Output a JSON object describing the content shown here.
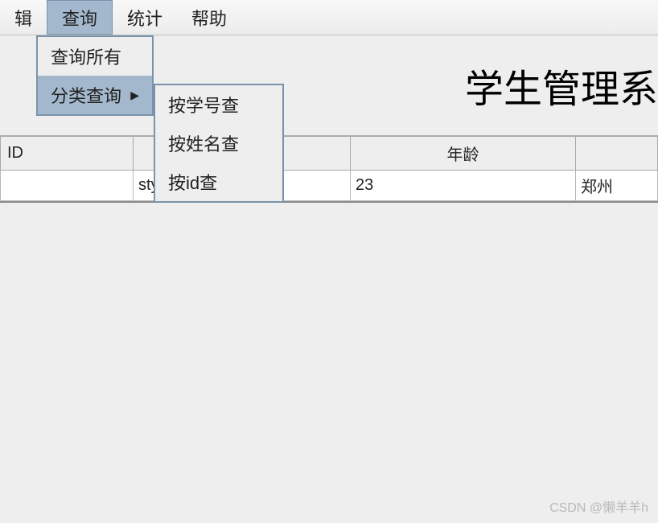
{
  "menubar": {
    "items": [
      {
        "label": "辑"
      },
      {
        "label": "查询"
      },
      {
        "label": "统计"
      },
      {
        "label": "帮助"
      }
    ],
    "active_index": 1
  },
  "dropdown": {
    "items": [
      {
        "label": "查询所有",
        "has_submenu": false
      },
      {
        "label": "分类查询",
        "has_submenu": true
      }
    ],
    "highlighted_index": 1
  },
  "submenu": {
    "items": [
      {
        "label": "按学号查"
      },
      {
        "label": "按姓名查"
      },
      {
        "label": "按id查"
      }
    ]
  },
  "title": "学生管理系",
  "table": {
    "headers": [
      "ID",
      "",
      "年龄",
      ""
    ],
    "rows": [
      {
        "c0": "",
        "c1": "sty",
        "c2": "23",
        "c3": "郑州"
      }
    ]
  },
  "watermark": "CSDN @懒羊羊h",
  "arrow_glyph": "▶"
}
